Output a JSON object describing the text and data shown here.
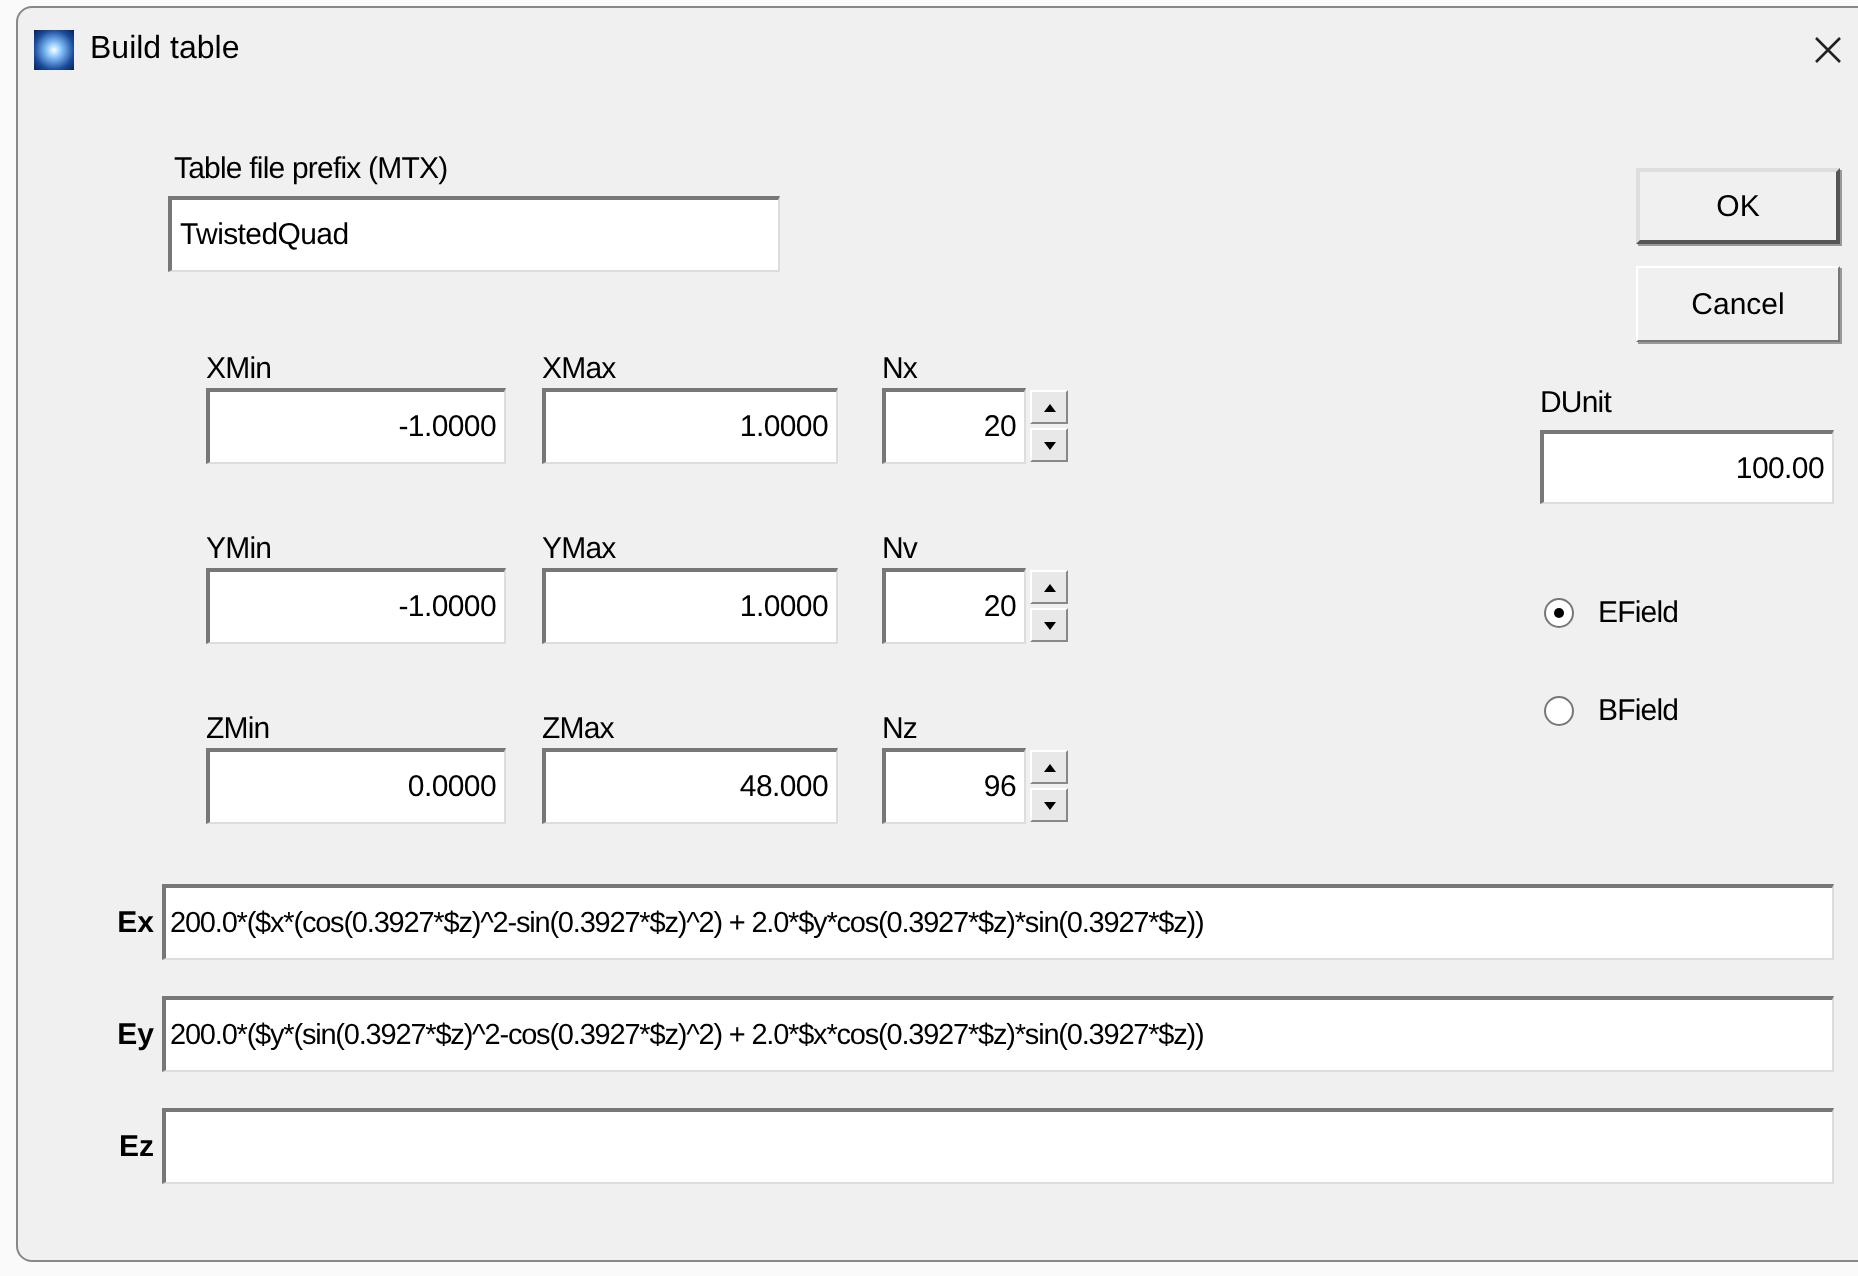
{
  "window": {
    "title": "Build table"
  },
  "prefix": {
    "label": "Table file prefix (MTX)",
    "value": "TwistedQuad"
  },
  "ranges": [
    {
      "min": {
        "label": "XMin",
        "value": "-1.0000"
      },
      "max": {
        "label": "XMax",
        "value": "1.0000"
      },
      "count": {
        "label": "Nx",
        "value": "20"
      }
    },
    {
      "min": {
        "label": "YMin",
        "value": "-1.0000"
      },
      "max": {
        "label": "YMax",
        "value": "1.0000"
      },
      "count": {
        "label": "Nv",
        "value": "20"
      }
    },
    {
      "min": {
        "label": "ZMin",
        "value": "0.0000"
      },
      "max": {
        "label": "ZMax",
        "value": "48.000"
      },
      "count": {
        "label": "Nz",
        "value": "96"
      }
    }
  ],
  "buttons": [
    {
      "label": "OK",
      "default": true
    },
    {
      "label": "Cancel",
      "default": false
    }
  ],
  "dunit": {
    "label": "DUnit",
    "value": "100.00"
  },
  "field_type": [
    {
      "label": "EField",
      "selected": true
    },
    {
      "label": "BField",
      "selected": false
    }
  ],
  "expressions": [
    {
      "label": "Ex",
      "value": "200.0*($x*(cos(0.3927*$z)^2-sin(0.3927*$z)^2) + 2.0*$y*cos(0.3927*$z)*sin(0.3927*$z))"
    },
    {
      "label": "Ey",
      "value": "200.0*($y*(sin(0.3927*$z)^2-cos(0.3927*$z)^2) + 2.0*$x*cos(0.3927*$z)*sin(0.3927*$z))"
    },
    {
      "label": "Ez"
    }
  ]
}
